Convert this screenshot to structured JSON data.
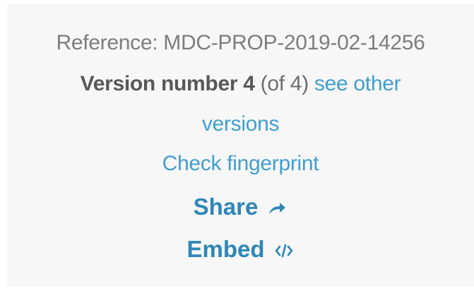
{
  "reference": {
    "text": "Reference: MDC-PROP-2019-02-14256"
  },
  "version": {
    "label": "Version number 4",
    "count": " (of 4) ",
    "see_other_link": "see other",
    "see_other_link_cont": "versions"
  },
  "fingerprint": {
    "label": "Check fingerprint"
  },
  "share": {
    "label": "Share",
    "icon": "share-arrow-icon"
  },
  "embed": {
    "label": "Embed",
    "icon": "code-icon"
  },
  "colors": {
    "link": "#3f9fcf",
    "action": "#2f86b8",
    "muted": "#7d7d7d",
    "panel_background": "#f7f7f7"
  }
}
